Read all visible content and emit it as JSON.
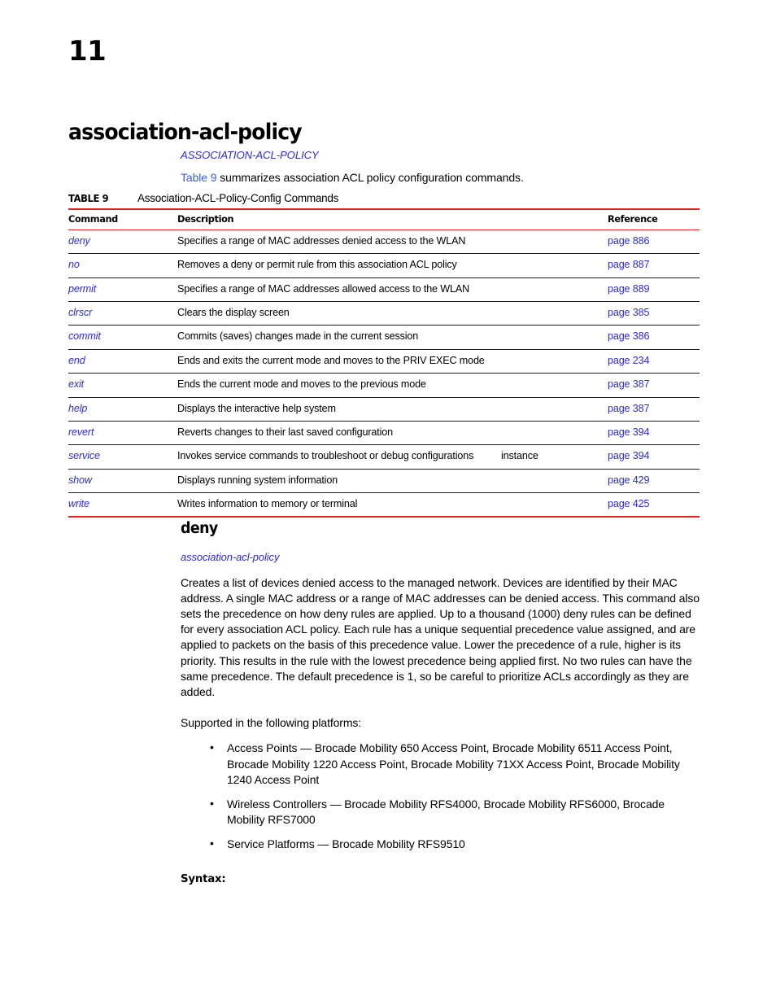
{
  "page": {
    "chapter_number": "11",
    "title": "association-acl-policy"
  },
  "intro": {
    "xref": "ASSOCIATION-ACL-POLICY",
    "link_text": "Table 9",
    "sentence_rest": " summarizes association ACL policy configuration commands."
  },
  "table": {
    "caption_label": "TABLE 9",
    "caption_text": "Association-ACL-Policy-Config Commands",
    "headers": {
      "command": "Command",
      "description": "Description",
      "reference": "Reference"
    },
    "rows": [
      {
        "command": "deny",
        "description": "Specifies a range of MAC addresses denied access to the WLAN",
        "note": "",
        "reference": "page 886"
      },
      {
        "command": "no",
        "description": "Removes a deny or permit rule from this association ACL policy",
        "note": "",
        "reference": "page 887"
      },
      {
        "command": "permit",
        "description": "Specifies a range of MAC addresses allowed access to the WLAN",
        "note": "",
        "reference": "page 889"
      },
      {
        "command": "clrscr",
        "description": "Clears the display screen",
        "note": "",
        "reference": "page 385"
      },
      {
        "command": "commit",
        "description": "Commits (saves) changes made in the current session",
        "note": "",
        "reference": "page 386"
      },
      {
        "command": "end",
        "description": "Ends and exits the current mode and moves to the PRIV EXEC mode",
        "note": "",
        "reference": "page 234"
      },
      {
        "command": "exit",
        "description": "Ends the current mode and moves to the previous mode",
        "note": "",
        "reference": "page 387"
      },
      {
        "command": "help",
        "description": "Displays the interactive help system",
        "note": "",
        "reference": "page 387"
      },
      {
        "command": "revert",
        "description": "Reverts changes to their last saved configuration",
        "note": "",
        "reference": "page 394"
      },
      {
        "command": "service",
        "description": "Invokes service commands to troubleshoot or debug configurations",
        "note": "instance",
        "reference": "page 394"
      },
      {
        "command": "show",
        "description": "Displays running system information",
        "note": "",
        "reference": "page 429"
      },
      {
        "command": "write",
        "description": "Writes information to memory or terminal",
        "note": "",
        "reference": "page 425"
      }
    ]
  },
  "deny_section": {
    "heading": "deny",
    "xref": "association-acl-policy",
    "description": "Creates a list of devices denied access to the managed network. Devices are identified by their MAC address. A single MAC address or a range of MAC addresses can be denied access. This command also sets the precedence on how deny rules are applied. Up to a thousand (1000) deny rules can be defined for every association ACL policy. Each rule has a unique sequential precedence value assigned, and are applied to packets on the basis of this precedence value. Lower the precedence of a rule, higher is its priority. This results in the rule with the lowest precedence being applied first. No two rules can have the same precedence. The default precedence is 1, so be careful to prioritize ACLs accordingly as they are added.",
    "platforms_lead": "Supported in the following platforms:",
    "bullet_glyph": "•",
    "platforms": [
      "Access Points — Brocade Mobility 650 Access Point, Brocade Mobility 6511 Access Point, Brocade Mobility 1220 Access Point, Brocade Mobility 71XX Access Point, Brocade Mobility 1240 Access Point",
      "Wireless Controllers — Brocade Mobility RFS4000, Brocade Mobility RFS6000, Brocade Mobility RFS7000",
      "Service Platforms — Brocade Mobility RFS9510"
    ],
    "syntax_label": "Syntax:"
  },
  "colors": {
    "rule_red": "#e8221f",
    "link_blue": "#2b2be0",
    "xref_blue": "#3b5be0",
    "text_black": "#000000"
  }
}
